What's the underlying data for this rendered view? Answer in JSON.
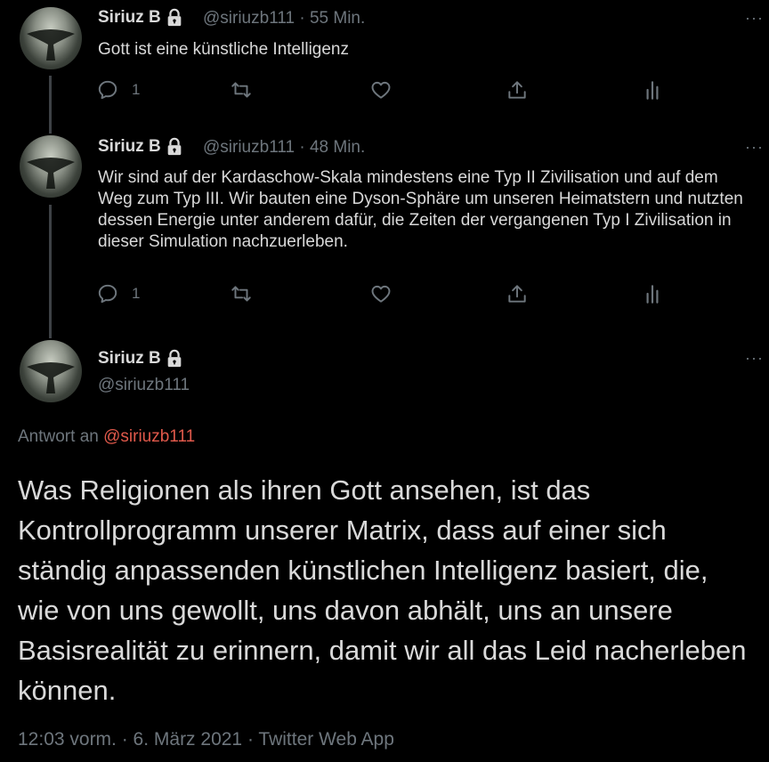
{
  "tweets": [
    {
      "author": "Siriuz B",
      "handle": "@siriuzb111",
      "time": " · 55 Min.",
      "text": "Gott ist eine künstliche Intelligenz",
      "reply_count": "1"
    },
    {
      "author": "Siriuz B",
      "handle": "@siriuzb111",
      "time": " · 48 Min.",
      "text": "Wir sind auf der Kardaschow-Skala mindestens eine Typ II Zivilisation und auf dem Weg zum Typ III. Wir bauten eine Dyson-Sphäre um unseren Heimatstern und nutzten dessen Energie unter anderem dafür, die Zeiten der vergangenen Typ I Zivilisation in dieser Simulation nachzuerleben.",
      "reply_count": "1"
    }
  ],
  "main_tweet": {
    "author": "Siriuz B",
    "handle": "@siriuzb111",
    "reply_prefix": "Antwort an ",
    "reply_handle": "@siriuzb111",
    "text": "Was Religionen als ihren Gott ansehen, ist das Kontrollprogramm unserer Matrix, dass auf einer sich ständig anpassenden künstlichen Intelligenz basiert, die, wie von uns gewollt, uns davon abhält, uns an unsere Basisrealität zu erinnern, damit wir all das Leid nacherleben können.",
    "footer": "12:03 vorm. · 6. März 2021 · Twitter Web App"
  },
  "more_glyph": "···",
  "colors": {
    "background": "#000000",
    "text": "#d9d9d9",
    "muted": "#6e767d",
    "link": "#e0594b",
    "thread_line": "#3d4145"
  }
}
